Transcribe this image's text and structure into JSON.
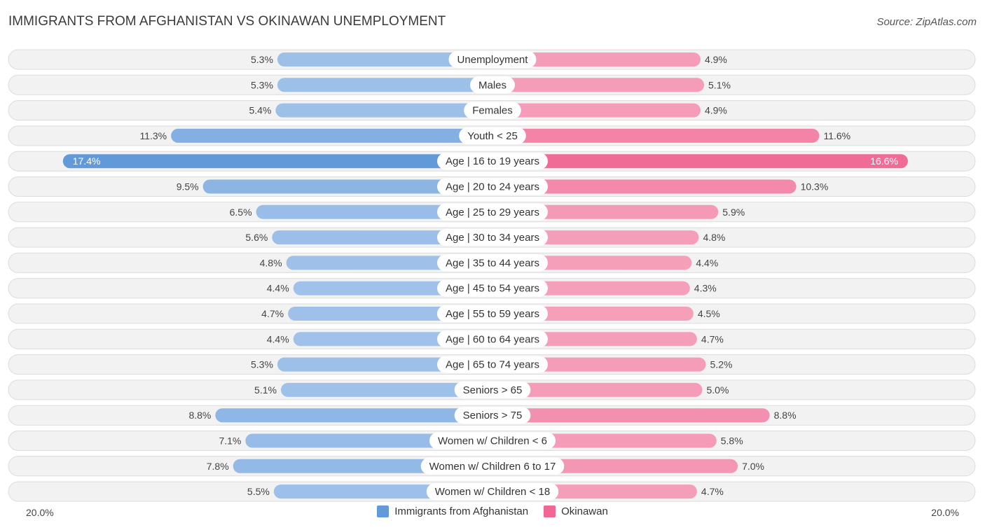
{
  "header": {
    "title": "IMMIGRANTS FROM AFGHANISTAN VS OKINAWAN UNEMPLOYMENT",
    "source": "Source: ZipAtlas.com"
  },
  "colors": {
    "left_strong": "#6199d9",
    "left_light": "#a9c8ec",
    "right_strong": "#f06793",
    "right_light": "#f6a7bf"
  },
  "chart_data": {
    "type": "bar",
    "orientation": "horizontal-diverging",
    "title": "IMMIGRANTS FROM AFGHANISTAN VS OKINAWAN UNEMPLOYMENT",
    "xlabel": "",
    "ylabel": "",
    "axis_min_label": "20.0%",
    "axis_max_label": "20.0%",
    "xlim": [
      0,
      20
    ],
    "legend_position": "bottom-center",
    "categories": [
      "Unemployment",
      "Males",
      "Females",
      "Youth < 25",
      "Age | 16 to 19 years",
      "Age | 20 to 24 years",
      "Age | 25 to 29 years",
      "Age | 30 to 34 years",
      "Age | 35 to 44 years",
      "Age | 45 to 54 years",
      "Age | 55 to 59 years",
      "Age | 60 to 64 years",
      "Age | 65 to 74 years",
      "Seniors > 65",
      "Seniors > 75",
      "Women w/ Children < 6",
      "Women w/ Children 6 to 17",
      "Women w/ Children < 18"
    ],
    "series": [
      {
        "name": "Immigrants from Afghanistan",
        "side": "left",
        "values": [
          5.3,
          5.3,
          5.4,
          11.3,
          17.4,
          9.5,
          6.5,
          5.6,
          4.8,
          4.4,
          4.7,
          4.4,
          5.3,
          5.1,
          8.8,
          7.1,
          7.8,
          5.5
        ],
        "labels": [
          "5.3%",
          "5.3%",
          "5.4%",
          "11.3%",
          "17.4%",
          "9.5%",
          "6.5%",
          "5.6%",
          "4.8%",
          "4.4%",
          "4.7%",
          "4.4%",
          "5.3%",
          "5.1%",
          "8.8%",
          "7.1%",
          "7.8%",
          "5.5%"
        ]
      },
      {
        "name": "Okinawan",
        "side": "right",
        "values": [
          4.9,
          5.1,
          4.9,
          11.6,
          16.6,
          10.3,
          5.9,
          4.8,
          4.4,
          4.3,
          4.5,
          4.7,
          5.2,
          5.0,
          8.8,
          5.8,
          7.0,
          4.7
        ],
        "labels": [
          "4.9%",
          "5.1%",
          "4.9%",
          "11.6%",
          "16.6%",
          "10.3%",
          "5.9%",
          "4.8%",
          "4.4%",
          "4.3%",
          "4.5%",
          "4.7%",
          "5.2%",
          "5.0%",
          "8.8%",
          "5.8%",
          "7.0%",
          "4.7%"
        ]
      }
    ]
  },
  "legend": {
    "items": [
      {
        "label": "Immigrants from Afghanistan",
        "color": "#6199d9"
      },
      {
        "label": "Okinawan",
        "color": "#f06793"
      }
    ]
  }
}
